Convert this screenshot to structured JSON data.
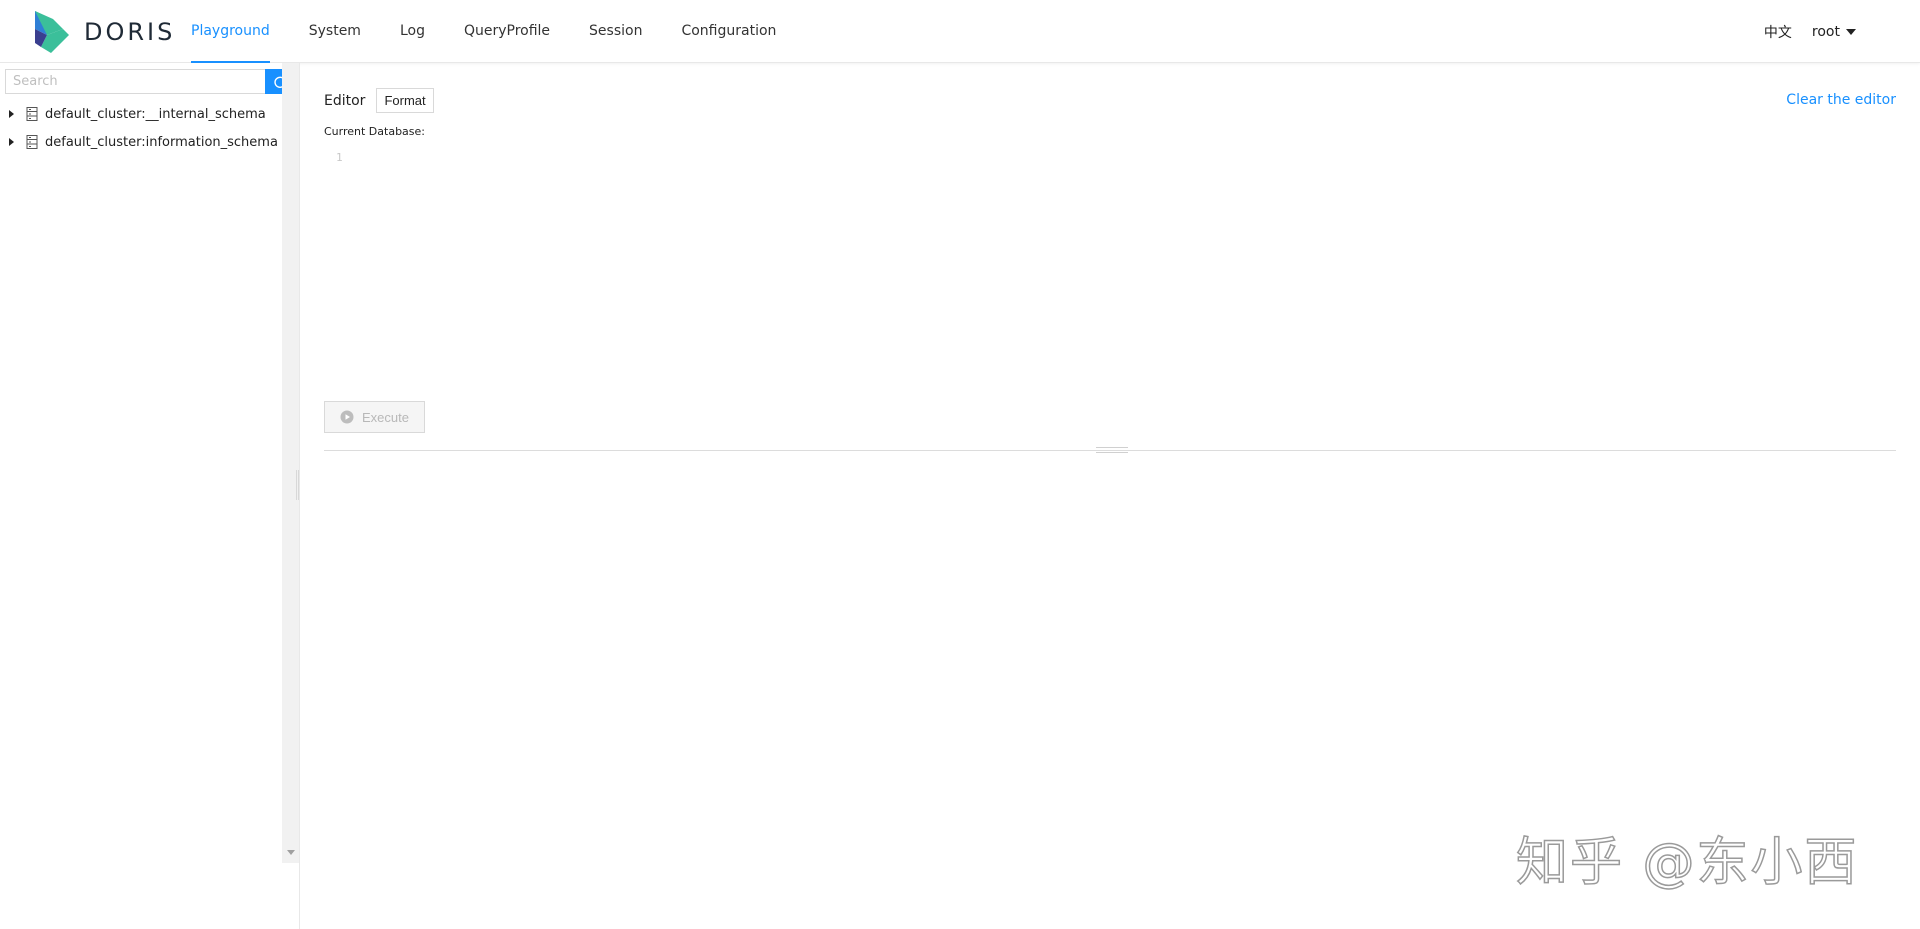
{
  "brand": {
    "name": "DORIS",
    "colors": {
      "teal": "#3bbf9a",
      "blue": "#2f7fd6",
      "navy": "#3a3f8f"
    }
  },
  "nav": {
    "items": [
      {
        "label": "Playground",
        "active": true
      },
      {
        "label": "System"
      },
      {
        "label": "Log"
      },
      {
        "label": "QueryProfile"
      },
      {
        "label": "Session"
      },
      {
        "label": "Configuration"
      }
    ]
  },
  "header": {
    "language": "中文",
    "user": "root"
  },
  "sidebar": {
    "search": {
      "placeholder": "Search",
      "value": ""
    },
    "tree": [
      {
        "label": "default_cluster:__internal_schema",
        "icon": "database-icon"
      },
      {
        "label": "default_cluster:information_schema",
        "icon": "database-icon"
      }
    ]
  },
  "editor": {
    "label": "Editor",
    "format_label": "Format",
    "clear_label": "Clear the editor",
    "current_database_label": "Current Database:",
    "line_numbers": [
      "1"
    ],
    "execute_label": "Execute"
  },
  "watermark": "知乎 @东小西",
  "accent_color": "#1890ff"
}
